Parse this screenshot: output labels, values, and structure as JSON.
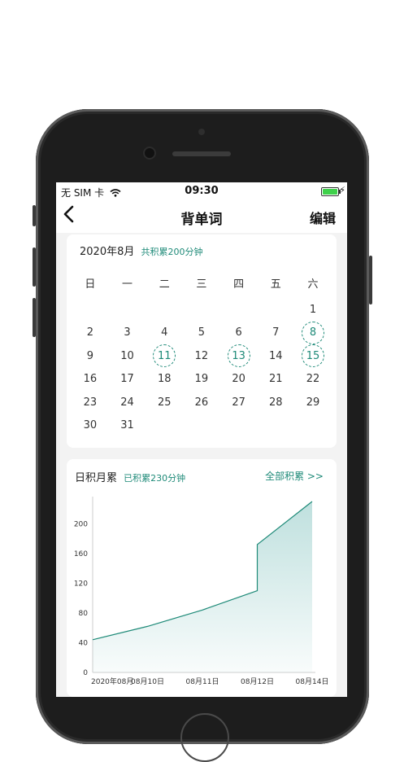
{
  "status_bar": {
    "carrier": "无 SIM 卡",
    "time": "09:30"
  },
  "nav": {
    "title": "背单词",
    "edit_label": "编辑"
  },
  "calendar": {
    "month_label": "2020年8月",
    "total_label": "共积累200分钟",
    "weekdays": [
      "日",
      "一",
      "二",
      "三",
      "四",
      "五",
      "六"
    ],
    "weeks": [
      [
        "",
        "",
        "",
        "",
        "",
        "",
        "1"
      ],
      [
        "2",
        "3",
        "4",
        "5",
        "6",
        "7",
        "8"
      ],
      [
        "9",
        "10",
        "11",
        "12",
        "13",
        "14",
        "15"
      ],
      [
        "16",
        "17",
        "18",
        "19",
        "20",
        "21",
        "22"
      ],
      [
        "23",
        "24",
        "25",
        "26",
        "27",
        "28",
        "29"
      ],
      [
        "30",
        "31",
        "",
        "",
        "",
        "",
        ""
      ]
    ],
    "marked_days": [
      "8",
      "11",
      "13",
      "15"
    ],
    "accent_color": "#1e8a78"
  },
  "chart_section": {
    "title": "日积月累",
    "total_label": "已积累230分钟",
    "link_label": "全部积累 >>"
  },
  "chart_data": {
    "type": "area",
    "categories": [
      "2020年08月",
      "08月10日",
      "08月11日",
      "08月12日",
      "08月14日"
    ],
    "x": [
      0,
      1,
      2,
      3,
      3,
      4
    ],
    "values": [
      44,
      62,
      84,
      110,
      172,
      230
    ],
    "y_ticks": [
      "0",
      "40",
      "80",
      "120",
      "160",
      "200"
    ],
    "ylim": [
      0,
      230
    ],
    "title": "",
    "xlabel": "",
    "ylabel": "",
    "line_color": "#1e8a78",
    "fill_color": "#bfe0de",
    "grid": false
  }
}
